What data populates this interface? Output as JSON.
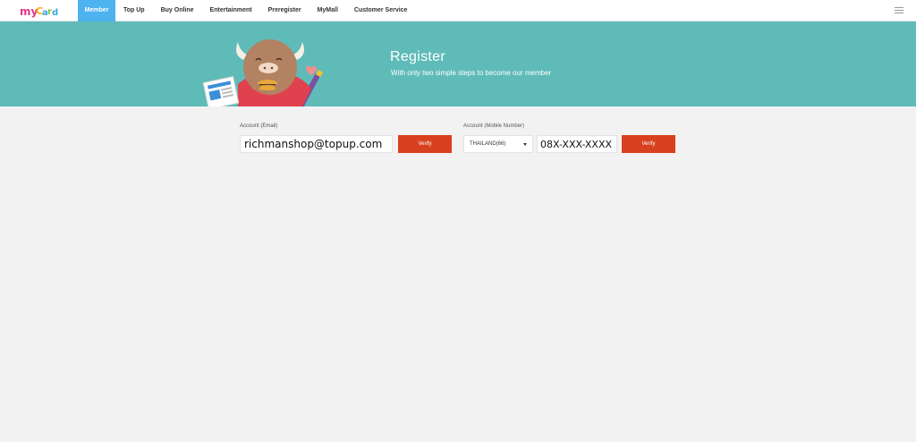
{
  "logo": {
    "text": "myCard"
  },
  "nav": {
    "items": [
      {
        "label": "Member",
        "active": true
      },
      {
        "label": "Top Up"
      },
      {
        "label": "Buy Online"
      },
      {
        "label": "Entertainment"
      },
      {
        "label": "Preregister"
      },
      {
        "label": "MyMall"
      },
      {
        "label": "Customer Service"
      }
    ]
  },
  "banner": {
    "title": "Register",
    "subtitle": "With only two simple steps to become our member"
  },
  "email_section": {
    "label": "Account (Email)",
    "value": "richmanshop@topup.com",
    "verify_label": "Verify"
  },
  "mobile_section": {
    "label": "Account (Mobile Number)",
    "country": "THAILAND(66)",
    "value": "08X-XXX-XXXX",
    "verify_label": "Verify"
  },
  "colors": {
    "nav_active": "#4cb2f0",
    "banner_bg": "#5fbbb8",
    "verify_btn": "#d8401f",
    "page_bg": "#f2f2f2"
  }
}
